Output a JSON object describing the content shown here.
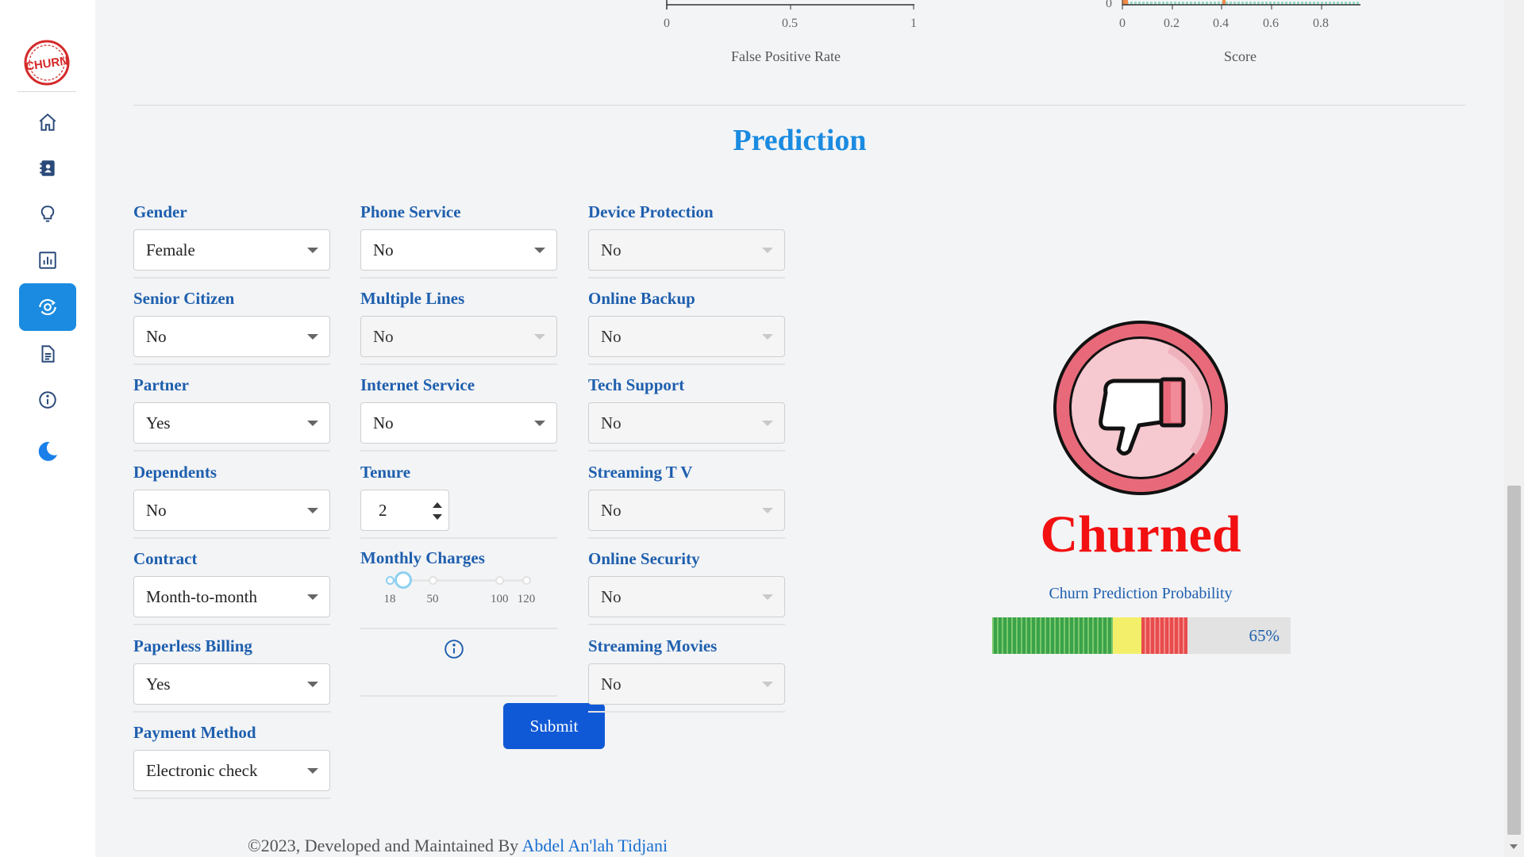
{
  "sidebar": {
    "logo_text": "CHURN",
    "items": [
      {
        "name": "home",
        "icon": "home-icon"
      },
      {
        "name": "contacts",
        "icon": "contact-book-icon"
      },
      {
        "name": "insights",
        "icon": "lightbulb-icon"
      },
      {
        "name": "charts",
        "icon": "bar-chart-icon"
      },
      {
        "name": "prediction",
        "icon": "eye-refresh-icon",
        "active": true
      },
      {
        "name": "docs",
        "icon": "document-icon"
      },
      {
        "name": "about",
        "icon": "info-icon"
      },
      {
        "name": "theme",
        "icon": "moon-icon"
      }
    ]
  },
  "top_charts": {
    "roc": {
      "xlabel": "False Positive Rate",
      "ticks": [
        "0",
        "0.5",
        "1"
      ],
      "y_tick": ""
    },
    "hist": {
      "xlabel": "Score",
      "ticks": [
        "0",
        "0.2",
        "0.4",
        "0.6",
        "0.8"
      ],
      "y_tick": "0"
    }
  },
  "page_title": "Prediction",
  "form": {
    "col1": [
      {
        "label": "Gender",
        "value": "Female"
      },
      {
        "label": "Senior Citizen",
        "value": "No"
      },
      {
        "label": "Partner",
        "value": "Yes"
      },
      {
        "label": "Dependents",
        "value": "No"
      },
      {
        "label": "Contract",
        "value": "Month-to-month"
      },
      {
        "label": "Paperless Billing",
        "value": "Yes"
      },
      {
        "label": "Payment Method",
        "value": "Electronic check"
      }
    ],
    "col2": {
      "phone_service": {
        "label": "Phone Service",
        "value": "No"
      },
      "multiple_lines": {
        "label": "Multiple Lines",
        "value": "No"
      },
      "internet_service": {
        "label": "Internet Service",
        "value": "No"
      },
      "tenure": {
        "label": "Tenure",
        "value": "2"
      },
      "monthly_charges": {
        "label": "Monthly Charges",
        "min": 18,
        "max": 120,
        "value": 28,
        "marks": [
          "18",
          "50",
          "100",
          "120"
        ],
        "mark_values": [
          18,
          50,
          100,
          120
        ]
      },
      "submit_label": "Submit"
    },
    "col3": [
      {
        "label": "Device Protection",
        "value": "No"
      },
      {
        "label": "Online Backup",
        "value": "No"
      },
      {
        "label": "Tech Support",
        "value": "No"
      },
      {
        "label": "Streaming T V",
        "value": "No"
      },
      {
        "label": "Online Security",
        "value": "No"
      },
      {
        "label": "Streaming Movies",
        "value": "No"
      }
    ]
  },
  "result": {
    "icon": "thumbs-down-icon",
    "label": "Churned",
    "label_color": "#f21010",
    "probability_label": "Churn Prediction Probability",
    "probability": 0.65,
    "probability_text": "65%"
  },
  "footer": {
    "prefix": "©2023, Developed and Maintained By",
    "author": "Abdel An'lah Tidjani"
  },
  "colors": {
    "accent": "#1a8be0",
    "label": "#1e5fae",
    "button": "#1059d6"
  }
}
